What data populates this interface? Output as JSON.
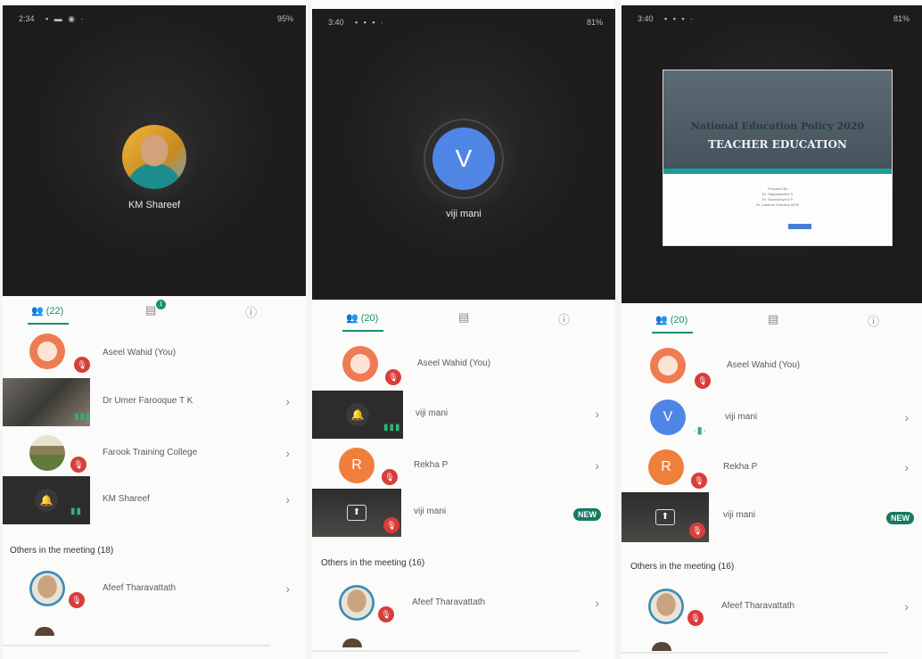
{
  "panels": [
    {
      "status": {
        "time": "2:34",
        "battery": "95%"
      },
      "video": {
        "type": "photo",
        "name": "KM Shareef"
      },
      "tabs": {
        "people": "(22)",
        "chat_badge": "1"
      },
      "participants": [
        {
          "name": "Aseel Wahid (You)",
          "avatar": "aseel",
          "muted": true
        },
        {
          "name": "Dr Umer Farooque T K",
          "avatar": "video",
          "speaking": true
        },
        {
          "name": "Farook Training College",
          "avatar": "farook",
          "muted": true
        },
        {
          "name": "KM Shareef",
          "avatar": "tile-bell",
          "speaking": true
        }
      ],
      "others_label": "Others in the meeting (18)",
      "others": [
        {
          "name": "Afeef Tharavattath",
          "muted": true
        }
      ]
    },
    {
      "status": {
        "time": "3:40",
        "battery": "81%"
      },
      "video": {
        "type": "letter",
        "letter": "V",
        "name": "viji mani"
      },
      "tabs": {
        "people": "(20)"
      },
      "participants": [
        {
          "name": "Aseel Wahid (You)",
          "avatar": "aseel",
          "muted": true
        },
        {
          "name": "viji mani",
          "avatar": "tile-bell",
          "speaking": true
        },
        {
          "name": "Rekha P",
          "avatar": "R",
          "muted": true
        },
        {
          "name": "viji mani",
          "avatar": "tile-present",
          "muted": true,
          "new": "NEW"
        }
      ],
      "others_label": "Others in the meeting (16)",
      "others": [
        {
          "name": "Afeef Tharavattath",
          "muted": true
        }
      ]
    },
    {
      "status": {
        "time": "3:40",
        "battery": "81%"
      },
      "video": {
        "type": "slide",
        "title1": "National Education Policy 2020",
        "title2": "TEACHER EDUCATION",
        "credits": [
          "Prepared By",
          "Dr. Vijayalakshmi S",
          "Dr. Sivamaniya K P",
          "Dr. Lakshmi Sumathy MFM"
        ]
      },
      "tabs": {
        "people": "(20)"
      },
      "participants": [
        {
          "name": "Aseel Wahid (You)",
          "avatar": "aseel",
          "muted": true
        },
        {
          "name": "viji mani",
          "avatar": "V",
          "speaking": true
        },
        {
          "name": "Rekha P",
          "avatar": "R",
          "muted": true
        },
        {
          "name": "viji mani",
          "avatar": "tile-present",
          "muted": true,
          "new": "NEW"
        }
      ],
      "others_label": "Others in the meeting (16)",
      "others": [
        {
          "name": "Afeef Tharavattath",
          "muted": true
        }
      ]
    }
  ],
  "icons": {
    "people": "people-icon",
    "chat": "chat-icon",
    "info": "info-icon",
    "chevron": "chevron-right-icon",
    "mic_off": "mic-off-icon",
    "bell": "bell-icon",
    "present": "present-screen-icon"
  },
  "colors": {
    "accent": "#1a8f74",
    "mute": "#d93d3a",
    "avatar_blue": "#4f86e6",
    "avatar_orange": "#f07e3c"
  }
}
